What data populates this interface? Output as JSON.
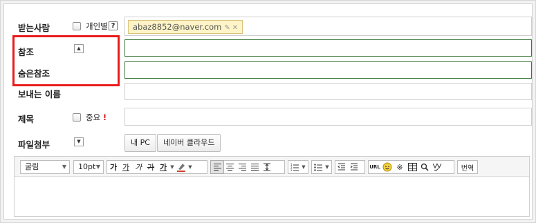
{
  "labels": {
    "to": "받는사람",
    "cc": "참조",
    "bcc": "숨은참조",
    "sender_name": "보내는 이름",
    "subject": "제목",
    "attachment": "파일첨부"
  },
  "recipient": {
    "individual_label": "개인별",
    "help": "?",
    "chip_email": "abaz8852@naver.com"
  },
  "subject": {
    "important_label": "중요",
    "important_mark": "!"
  },
  "attachment": {
    "pc_button": "내 PC",
    "cloud_button": "네이버 클라우드"
  },
  "editor": {
    "font_family": "굴림",
    "font_size": "10pt",
    "bold": "가",
    "underline": "가",
    "italic": "가",
    "strike": "가",
    "fontcolor": "가",
    "url": "URL",
    "translate": "번역"
  },
  "colors": {
    "highlight": "#ea1a1a",
    "chip_bg": "#fff4c7",
    "field_active_border": "#3c7a3c"
  }
}
